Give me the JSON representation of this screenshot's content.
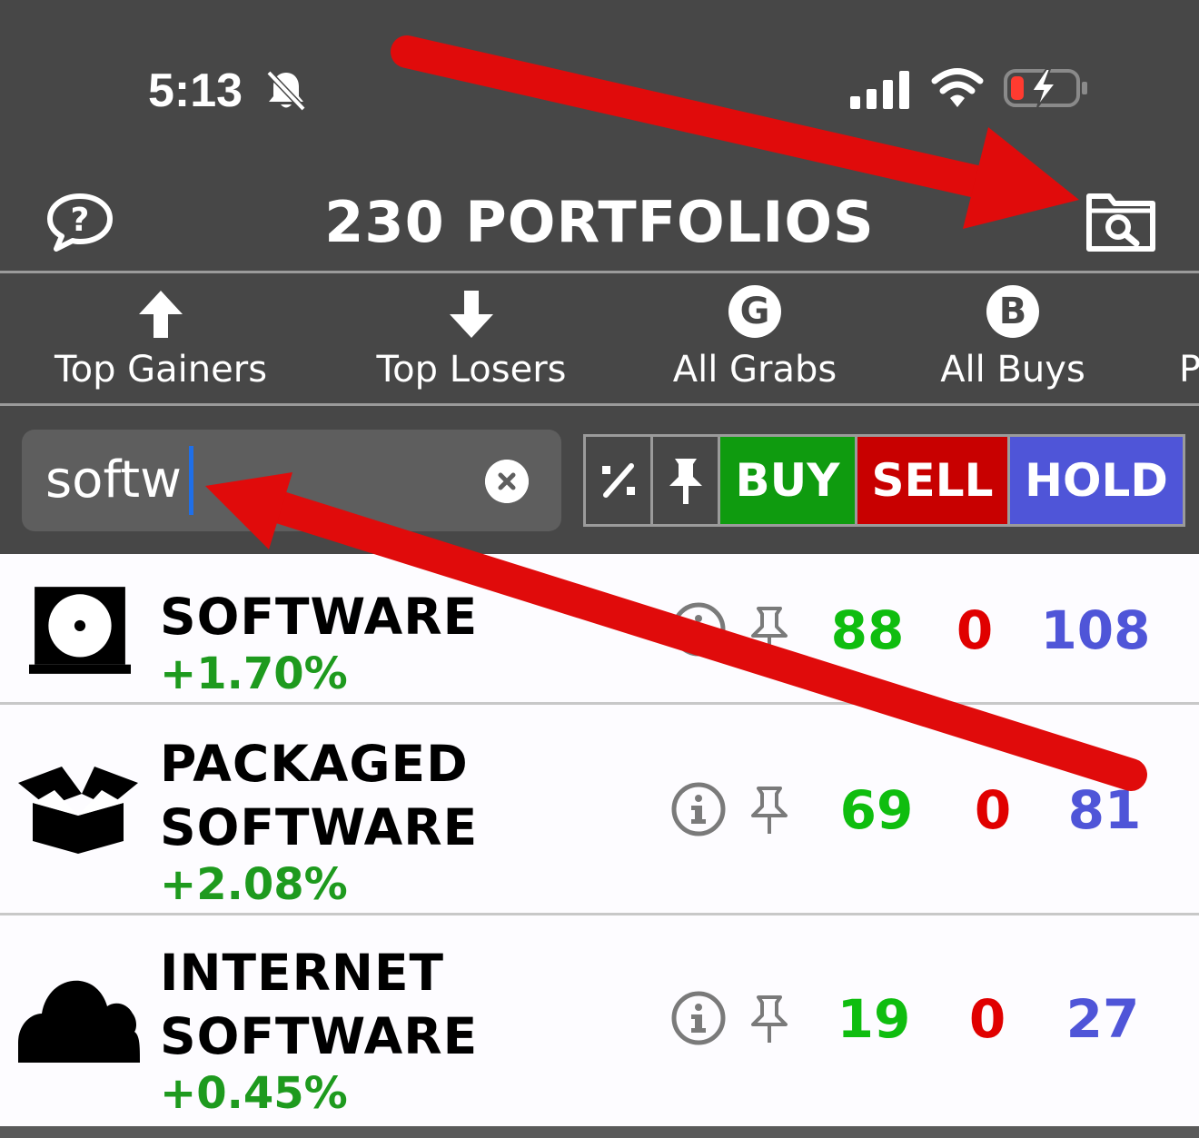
{
  "status_bar": {
    "time": "5:13",
    "icons": [
      "bell-slash-icon",
      "cellular-signal-icon",
      "wifi-icon",
      "battery-charging-icon"
    ]
  },
  "header": {
    "title": "230 PORTFOLIOS",
    "left_icon": "help-bubble-icon",
    "right_icon": "folder-search-icon"
  },
  "nav_tabs": [
    {
      "label": "Top Gainers",
      "icon": "arrow-up-icon"
    },
    {
      "label": "Top Losers",
      "icon": "arrow-down-icon"
    },
    {
      "label": "All Grabs",
      "icon": "g-badge-icon",
      "badge": "G"
    },
    {
      "label": "All Buys",
      "icon": "b-badge-icon",
      "badge": "B"
    },
    {
      "label": "P",
      "icon": ""
    }
  ],
  "search": {
    "value": "softw",
    "clear_icon": "clear-x-icon"
  },
  "filters": {
    "percent_icon": "percent-icon",
    "pin_icon": "pin-icon",
    "buy": "BUY",
    "sell": "SELL",
    "hold": "HOLD"
  },
  "rows": [
    {
      "name_lines": [
        "SOFTWARE"
      ],
      "change": "+1.70%",
      "buy": "88",
      "sell": "0",
      "hold": "108",
      "icon": "disc-drive-icon"
    },
    {
      "name_lines": [
        "PACKAGED",
        "SOFTWARE"
      ],
      "change": "+2.08%",
      "buy": "69",
      "sell": "0",
      "hold": "81",
      "icon": "open-box-icon"
    },
    {
      "name_lines": [
        "INTERNET",
        "SOFTWARE"
      ],
      "change": "+0.45%",
      "buy": "19",
      "sell": "0",
      "hold": "27",
      "icon": "cloud-icon"
    }
  ],
  "colors": {
    "background": "#474747",
    "buy": "#0f9b0f",
    "sell": "#c80000",
    "hold": "#4f55d8",
    "positive": "#1e9a1e",
    "annotation_arrow": "#e00b0b"
  }
}
